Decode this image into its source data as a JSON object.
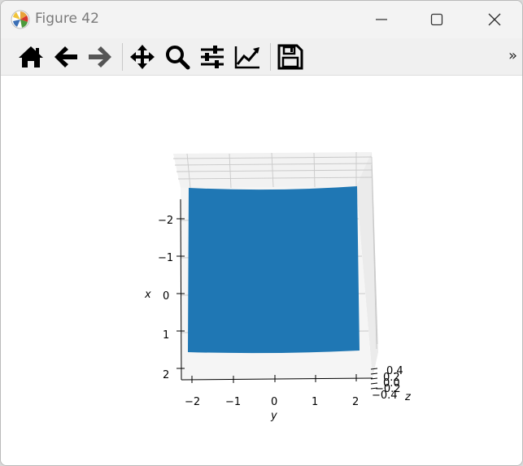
{
  "window": {
    "title": "Figure 42",
    "icon": "matplotlib-logo-icon",
    "controls": [
      "minimize-icon",
      "maximize-icon",
      "close-icon"
    ]
  },
  "toolbar": {
    "tools": [
      {
        "name": "home",
        "icon": "home-icon"
      },
      {
        "name": "back",
        "icon": "arrow-left-icon"
      },
      {
        "name": "forward",
        "icon": "arrow-right-icon"
      },
      {
        "name": "pan",
        "icon": "move-icon"
      },
      {
        "name": "zoom",
        "icon": "magnifier-icon"
      },
      {
        "name": "configure-subplots",
        "icon": "sliders-icon"
      },
      {
        "name": "edit-axes",
        "icon": "line-chart-icon"
      },
      {
        "name": "save",
        "icon": "floppy-disk-icon"
      }
    ],
    "overflow_label": "»"
  },
  "chart_data": {
    "type": "surface",
    "title": "",
    "xlabel": "x",
    "ylabel": "y",
    "zlabel": "z",
    "x_ticks": [
      "−2",
      "−1",
      "0",
      "1",
      "2"
    ],
    "y_ticks": [
      "−2",
      "−1",
      "0",
      "1",
      "2"
    ],
    "z_ticks": [
      "0.4",
      "0.2",
      "0.0",
      "−0.2",
      "−0.4"
    ],
    "xlim": [
      -2.5,
      2.5
    ],
    "ylim": [
      -2.5,
      2.5
    ],
    "zlim": [
      -0.5,
      0.5
    ],
    "surface_color": "#1f77b4",
    "grid": true,
    "view": "top-down, slightly tilted"
  }
}
